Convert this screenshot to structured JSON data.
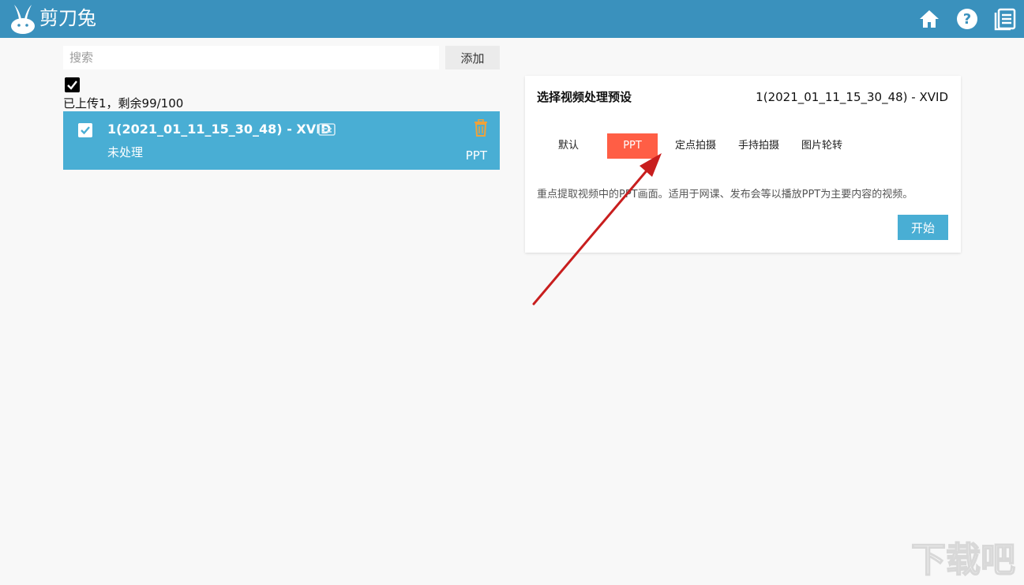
{
  "app": {
    "title": "剪刀兔"
  },
  "toolbar": {
    "home_icon": "home-icon",
    "help_icon": "help-icon",
    "log_icon": "document-list-icon"
  },
  "search": {
    "placeholder": "搜索",
    "value": ""
  },
  "add_button": "添加",
  "upload_status": "已上传1，剩余99/100",
  "files": [
    {
      "name": "1(2021_01_11_15_30_48) - XVID",
      "status": "未处理",
      "preset": "PPT",
      "checked": true
    }
  ],
  "panel": {
    "title": "选择视频处理预设",
    "file_name": "1(2021_01_11_15_30_48) - XVID",
    "tabs": [
      {
        "label": "默认",
        "active": false
      },
      {
        "label": "PPT",
        "active": true
      },
      {
        "label": "定点拍摄",
        "active": false
      },
      {
        "label": "手持拍摄",
        "active": false
      },
      {
        "label": "图片轮转",
        "active": false
      }
    ],
    "description": "重点提取视频中的PPT画面。适用于网课、发布会等以播放PPT为主要内容的视频。",
    "start_button": "开始"
  },
  "watermark": "下载吧",
  "colors": {
    "header": "#3a91bd",
    "selected_item": "#49aed4",
    "active_tab": "#ff5e45",
    "trash": "#f0a23a",
    "arrow": "#c81e1e"
  }
}
